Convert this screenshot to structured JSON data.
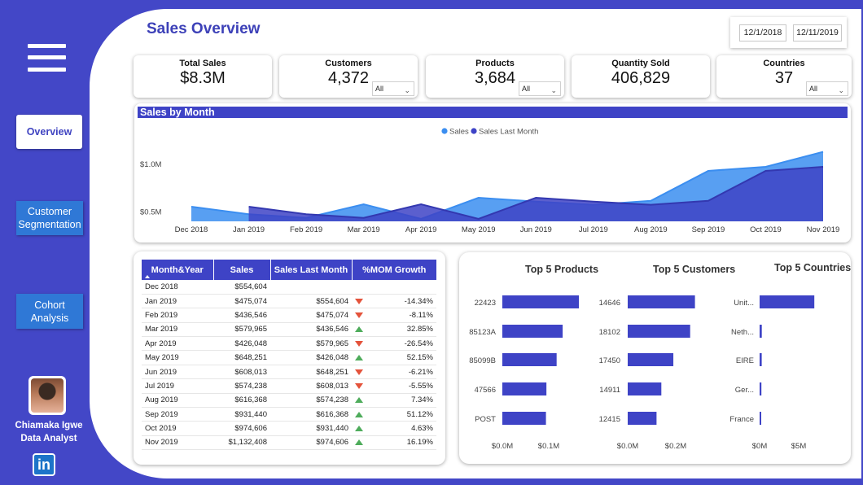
{
  "sidebar": {
    "nav": [
      {
        "label": "Overview"
      },
      {
        "label": "Customer Segmentation"
      },
      {
        "label": "Cohort Analysis"
      }
    ],
    "profile": {
      "name": "Chiamaka Igwe",
      "role": "Data Analyst"
    },
    "linkedin_label": "in"
  },
  "header": {
    "title": "Sales Overview",
    "date_from": "12/1/2018",
    "date_to": "12/11/2019"
  },
  "kpis": [
    {
      "label": "Total Sales",
      "value": "$8.3M"
    },
    {
      "label": "Customers",
      "value": "4,372",
      "filter": "All"
    },
    {
      "label": "Products",
      "value": "3,684",
      "filter": "All"
    },
    {
      "label": "Quantity Sold",
      "value": "406,829"
    },
    {
      "label": "Countries",
      "value": "37",
      "filter": "All"
    }
  ],
  "colors": {
    "accent": "#3e43c6",
    "sales": "#3b8ef0",
    "sales_last_month": "#3e43c6",
    "up": "#4eac5b",
    "down": "#e4533b"
  },
  "chart_data": [
    {
      "type": "area",
      "title": "Sales by Month",
      "x": [
        "Dec 2018",
        "Jan 2019",
        "Feb 2019",
        "Mar 2019",
        "Apr 2019",
        "May 2019",
        "Jun 2019",
        "Jul 2019",
        "Aug 2019",
        "Sep 2019",
        "Oct 2019",
        "Nov 2019"
      ],
      "series": [
        {
          "name": "Sales",
          "values": [
            554604,
            475074,
            436546,
            579965,
            426048,
            648251,
            608013,
            574238,
            616368,
            931440,
            974600,
            1132408
          ]
        },
        {
          "name": "Sales Last Month",
          "values": [
            null,
            554604,
            475074,
            436546,
            579965,
            426048,
            648251,
            608013,
            574238,
            616368,
            931440,
            974600
          ]
        }
      ],
      "yticks": [
        "$0.5M",
        "$1.0M"
      ],
      "ytick_values": [
        500000,
        1000000
      ],
      "legend_position": "top-center"
    },
    {
      "type": "bar",
      "orientation": "horizontal",
      "title": "Top 5 Products",
      "categories": [
        "22423",
        "85123A",
        "85099B",
        "47566",
        "POST"
      ],
      "values": [
        0.165,
        0.13,
        0.117,
        0.095,
        0.094
      ],
      "xticks": [
        "$0.0M",
        "$0.1M"
      ],
      "xtick_values": [
        0,
        0.1
      ]
    },
    {
      "type": "bar",
      "orientation": "horizontal",
      "title": "Top 5 Customers",
      "categories": [
        "14646",
        "18102",
        "17450",
        "14911",
        "12415"
      ],
      "values": [
        0.28,
        0.26,
        0.19,
        0.14,
        0.12
      ],
      "xticks": [
        "$0.0M",
        "$0.2M"
      ],
      "xtick_values": [
        0,
        0.2
      ]
    },
    {
      "type": "bar",
      "orientation": "horizontal",
      "title": "Top 5 Countries",
      "categories": [
        "Unit...",
        "Neth...",
        "EIRE",
        "Ger...",
        "France"
      ],
      "values": [
        7.0,
        0.28,
        0.27,
        0.23,
        0.2
      ],
      "xticks": [
        "$0M",
        "$5M"
      ],
      "xtick_values": [
        0,
        5
      ]
    }
  ],
  "table": {
    "columns": [
      "Month&Year",
      "Sales",
      "Sales Last Month",
      "%MOM Growth"
    ],
    "rows": [
      {
        "month": "Dec 2018",
        "sales": "$554,604",
        "last": "",
        "dir": "",
        "growth": ""
      },
      {
        "month": "Jan 2019",
        "sales": "$475,074",
        "last": "$554,604",
        "dir": "down",
        "growth": "-14.34%"
      },
      {
        "month": "Feb 2019",
        "sales": "$436,546",
        "last": "$475,074",
        "dir": "down",
        "growth": "-8.11%"
      },
      {
        "month": "Mar 2019",
        "sales": "$579,965",
        "last": "$436,546",
        "dir": "up",
        "growth": "32.85%"
      },
      {
        "month": "Apr 2019",
        "sales": "$426,048",
        "last": "$579,965",
        "dir": "down",
        "growth": "-26.54%"
      },
      {
        "month": "May 2019",
        "sales": "$648,251",
        "last": "$426,048",
        "dir": "up",
        "growth": "52.15%"
      },
      {
        "month": "Jun 2019",
        "sales": "$608,013",
        "last": "$648,251",
        "dir": "down",
        "growth": "-6.21%"
      },
      {
        "month": "Jul 2019",
        "sales": "$574,238",
        "last": "$608,013",
        "dir": "down",
        "growth": "-5.55%"
      },
      {
        "month": "Aug 2019",
        "sales": "$616,368",
        "last": "$574,238",
        "dir": "up",
        "growth": "7.34%"
      },
      {
        "month": "Sep 2019",
        "sales": "$931,440",
        "last": "$616,368",
        "dir": "up",
        "growth": "51.12%"
      },
      {
        "month": "Oct 2019",
        "sales": "$974,606",
        "last": "$931,440",
        "dir": "up",
        "growth": "4.63%"
      },
      {
        "month": "Nov 2019",
        "sales": "$1,132,408",
        "last": "$974,606",
        "dir": "up",
        "growth": "16.19%"
      }
    ]
  }
}
